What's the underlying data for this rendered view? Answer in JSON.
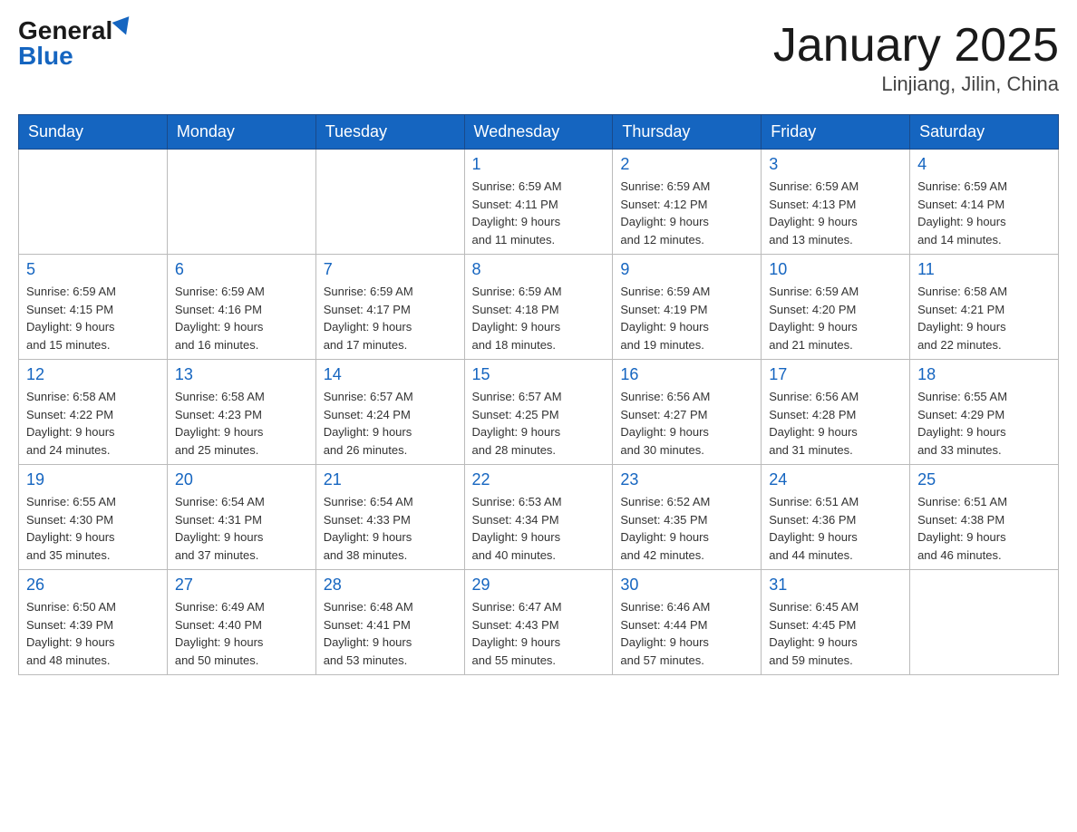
{
  "header": {
    "logo_general": "General",
    "logo_blue": "Blue",
    "title": "January 2025",
    "subtitle": "Linjiang, Jilin, China"
  },
  "days_of_week": [
    "Sunday",
    "Monday",
    "Tuesday",
    "Wednesday",
    "Thursday",
    "Friday",
    "Saturday"
  ],
  "weeks": [
    {
      "days": [
        {
          "number": "",
          "info": ""
        },
        {
          "number": "",
          "info": ""
        },
        {
          "number": "",
          "info": ""
        },
        {
          "number": "1",
          "info": "Sunrise: 6:59 AM\nSunset: 4:11 PM\nDaylight: 9 hours\nand 11 minutes."
        },
        {
          "number": "2",
          "info": "Sunrise: 6:59 AM\nSunset: 4:12 PM\nDaylight: 9 hours\nand 12 minutes."
        },
        {
          "number": "3",
          "info": "Sunrise: 6:59 AM\nSunset: 4:13 PM\nDaylight: 9 hours\nand 13 minutes."
        },
        {
          "number": "4",
          "info": "Sunrise: 6:59 AM\nSunset: 4:14 PM\nDaylight: 9 hours\nand 14 minutes."
        }
      ]
    },
    {
      "days": [
        {
          "number": "5",
          "info": "Sunrise: 6:59 AM\nSunset: 4:15 PM\nDaylight: 9 hours\nand 15 minutes."
        },
        {
          "number": "6",
          "info": "Sunrise: 6:59 AM\nSunset: 4:16 PM\nDaylight: 9 hours\nand 16 minutes."
        },
        {
          "number": "7",
          "info": "Sunrise: 6:59 AM\nSunset: 4:17 PM\nDaylight: 9 hours\nand 17 minutes."
        },
        {
          "number": "8",
          "info": "Sunrise: 6:59 AM\nSunset: 4:18 PM\nDaylight: 9 hours\nand 18 minutes."
        },
        {
          "number": "9",
          "info": "Sunrise: 6:59 AM\nSunset: 4:19 PM\nDaylight: 9 hours\nand 19 minutes."
        },
        {
          "number": "10",
          "info": "Sunrise: 6:59 AM\nSunset: 4:20 PM\nDaylight: 9 hours\nand 21 minutes."
        },
        {
          "number": "11",
          "info": "Sunrise: 6:58 AM\nSunset: 4:21 PM\nDaylight: 9 hours\nand 22 minutes."
        }
      ]
    },
    {
      "days": [
        {
          "number": "12",
          "info": "Sunrise: 6:58 AM\nSunset: 4:22 PM\nDaylight: 9 hours\nand 24 minutes."
        },
        {
          "number": "13",
          "info": "Sunrise: 6:58 AM\nSunset: 4:23 PM\nDaylight: 9 hours\nand 25 minutes."
        },
        {
          "number": "14",
          "info": "Sunrise: 6:57 AM\nSunset: 4:24 PM\nDaylight: 9 hours\nand 26 minutes."
        },
        {
          "number": "15",
          "info": "Sunrise: 6:57 AM\nSunset: 4:25 PM\nDaylight: 9 hours\nand 28 minutes."
        },
        {
          "number": "16",
          "info": "Sunrise: 6:56 AM\nSunset: 4:27 PM\nDaylight: 9 hours\nand 30 minutes."
        },
        {
          "number": "17",
          "info": "Sunrise: 6:56 AM\nSunset: 4:28 PM\nDaylight: 9 hours\nand 31 minutes."
        },
        {
          "number": "18",
          "info": "Sunrise: 6:55 AM\nSunset: 4:29 PM\nDaylight: 9 hours\nand 33 minutes."
        }
      ]
    },
    {
      "days": [
        {
          "number": "19",
          "info": "Sunrise: 6:55 AM\nSunset: 4:30 PM\nDaylight: 9 hours\nand 35 minutes."
        },
        {
          "number": "20",
          "info": "Sunrise: 6:54 AM\nSunset: 4:31 PM\nDaylight: 9 hours\nand 37 minutes."
        },
        {
          "number": "21",
          "info": "Sunrise: 6:54 AM\nSunset: 4:33 PM\nDaylight: 9 hours\nand 38 minutes."
        },
        {
          "number": "22",
          "info": "Sunrise: 6:53 AM\nSunset: 4:34 PM\nDaylight: 9 hours\nand 40 minutes."
        },
        {
          "number": "23",
          "info": "Sunrise: 6:52 AM\nSunset: 4:35 PM\nDaylight: 9 hours\nand 42 minutes."
        },
        {
          "number": "24",
          "info": "Sunrise: 6:51 AM\nSunset: 4:36 PM\nDaylight: 9 hours\nand 44 minutes."
        },
        {
          "number": "25",
          "info": "Sunrise: 6:51 AM\nSunset: 4:38 PM\nDaylight: 9 hours\nand 46 minutes."
        }
      ]
    },
    {
      "days": [
        {
          "number": "26",
          "info": "Sunrise: 6:50 AM\nSunset: 4:39 PM\nDaylight: 9 hours\nand 48 minutes."
        },
        {
          "number": "27",
          "info": "Sunrise: 6:49 AM\nSunset: 4:40 PM\nDaylight: 9 hours\nand 50 minutes."
        },
        {
          "number": "28",
          "info": "Sunrise: 6:48 AM\nSunset: 4:41 PM\nDaylight: 9 hours\nand 53 minutes."
        },
        {
          "number": "29",
          "info": "Sunrise: 6:47 AM\nSunset: 4:43 PM\nDaylight: 9 hours\nand 55 minutes."
        },
        {
          "number": "30",
          "info": "Sunrise: 6:46 AM\nSunset: 4:44 PM\nDaylight: 9 hours\nand 57 minutes."
        },
        {
          "number": "31",
          "info": "Sunrise: 6:45 AM\nSunset: 4:45 PM\nDaylight: 9 hours\nand 59 minutes."
        },
        {
          "number": "",
          "info": ""
        }
      ]
    }
  ]
}
